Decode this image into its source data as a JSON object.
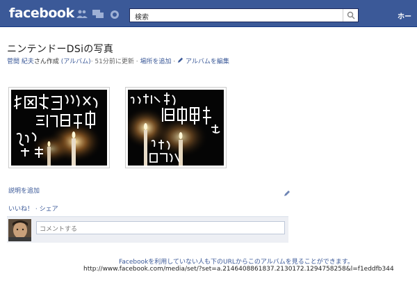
{
  "topbar": {
    "logo": "facebook",
    "search_placeholder": "検索",
    "home_label": "ホー",
    "icons": [
      "friend-requests-icon",
      "messages-icon",
      "notifications-icon",
      "search-icon"
    ]
  },
  "album": {
    "title": "ニンテンドーDSiの写真",
    "owner": "菅間 紀夫",
    "created_by": "さん作成",
    "album_link": "(アルバム)",
    "updated": "· 51分前に更新 ·",
    "add_place": "場所を追加",
    "edit_album": "アルバムを編集",
    "photos": [
      {
        "caption": "北関東大震災のため計画停電中 ろうそく2本"
      },
      {
        "caption": "ろうそく2本と懐中電灯1つ けっこう明るい"
      }
    ]
  },
  "actions": {
    "add_description": "説明を追加",
    "like": "いいね！",
    "separator": "·",
    "share": "シェア",
    "comment_placeholder": "コメントする"
  },
  "footer": {
    "notice": "Facebookを利用していない人も下のURLからこのアルバムを見ることができます。",
    "url": "http://www.facebook.com/media/set/?set=a.2146408861837.2130172.1294758258&l=f1eddfb344"
  },
  "colors": {
    "brand": "#3b5998",
    "link": "#3b5998",
    "comment_bg": "#edeff4"
  }
}
